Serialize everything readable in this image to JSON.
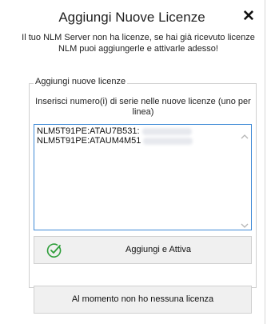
{
  "dialog": {
    "title": "Aggiungi Nuove Licenze",
    "close_symbol": "✕",
    "intro_text": "Il tuo NLM Server non ha licenze, se hai già ricevuto licenze NLM puoi aggiungerle e attivarle adesso!"
  },
  "add_group": {
    "legend": "Aggiungi nuove licenze",
    "instructions": "Inserisci numero(i) di serie nelle nuove licenze (uno per linea)",
    "serials": [
      "NLM5T91PE:ATAU7B531:",
      "NLM5T91PE:ATAUM4M51"
    ],
    "add_activate_label": "Aggiungi e Attiva",
    "add_activate_icon": "check-circle-icon"
  },
  "no_license_label": "Al momento non ho nessuna licenza",
  "colors": {
    "accent_border": "#3f8ad6",
    "check_icon": "#2e9e3a"
  }
}
